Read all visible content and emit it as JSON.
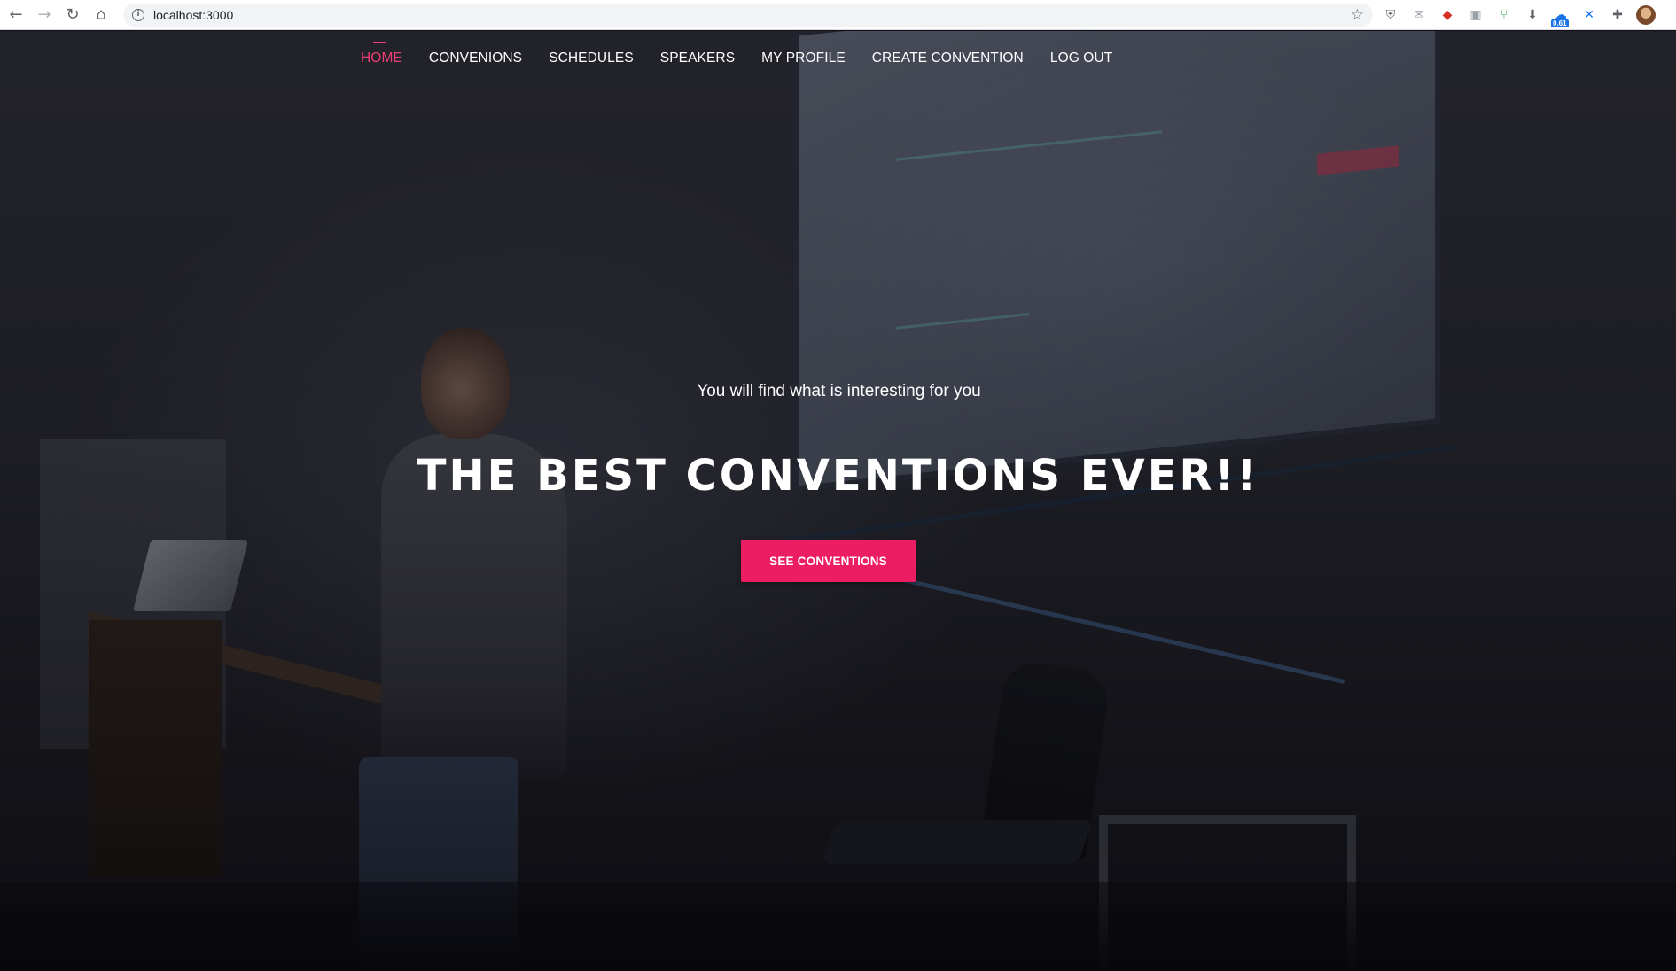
{
  "browser": {
    "back_icon": "←",
    "forward_icon": "→",
    "reload_icon": "↻",
    "home_icon": "⌂",
    "info_icon": "i",
    "url": "localhost:3000",
    "star_icon": "☆",
    "extensions": [
      {
        "name": "shield-extension-icon",
        "glyph": "⛨"
      },
      {
        "name": "mail-extension-icon",
        "glyph": "✉"
      },
      {
        "name": "diamond-extension-icon",
        "glyph": "◆"
      },
      {
        "name": "chat-extension-icon",
        "glyph": "▣"
      },
      {
        "name": "git-branch-extension-icon",
        "glyph": "⑂"
      },
      {
        "name": "download-extension-icon",
        "glyph": "⬇"
      },
      {
        "name": "speed-extension-icon",
        "glyph": "☁",
        "badge": "0.61"
      },
      {
        "name": "tool-extension-icon",
        "glyph": "✕"
      },
      {
        "name": "puzzle-extension-icon",
        "glyph": "✚"
      }
    ]
  },
  "site_nav": {
    "items": [
      {
        "label": "HOME",
        "active": true
      },
      {
        "label": "CONVENIONS",
        "active": false
      },
      {
        "label": "SCHEDULES",
        "active": false
      },
      {
        "label": "SPEAKERS",
        "active": false
      },
      {
        "label": "MY PROFILE",
        "active": false
      },
      {
        "label": "CREATE CONVENTION",
        "active": false
      },
      {
        "label": "LOG OUT",
        "active": false
      }
    ]
  },
  "hero": {
    "subtitle": "You will find what is interesting for you",
    "title": "THE BEST CONVENTIONS EVER!!",
    "cta_label": "SEE CONVENTIONS"
  },
  "colors": {
    "accent": "#ec1d63",
    "nav_active": "#ec3f74",
    "text": "#ffffff"
  }
}
